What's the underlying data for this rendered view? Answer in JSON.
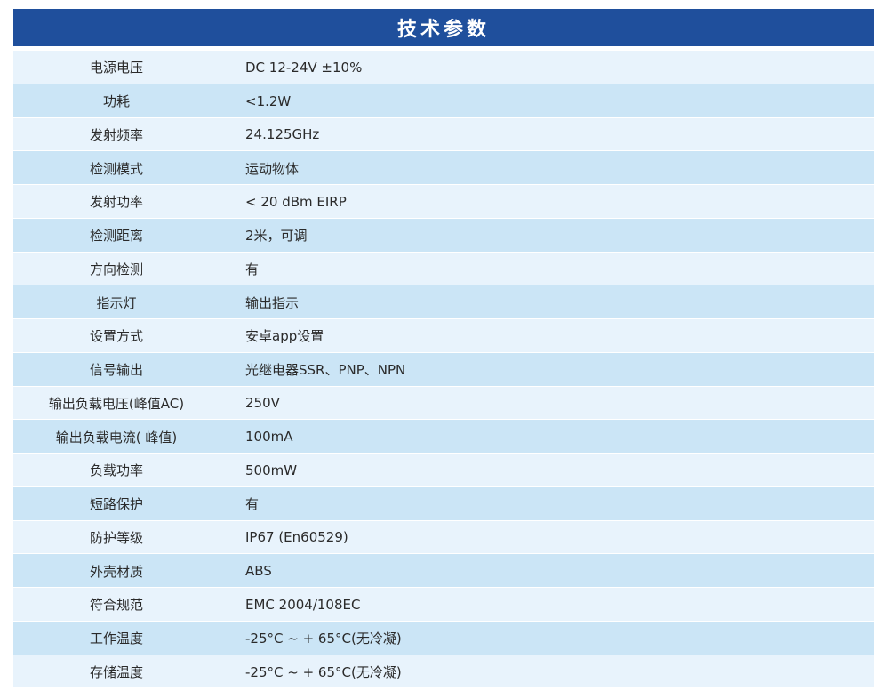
{
  "title": "技术参数",
  "rows": [
    {
      "label": "电源电压",
      "value": "DC 12-24V ±10%"
    },
    {
      "label": "功耗",
      "value": "<1.2W"
    },
    {
      "label": "发射频率",
      "value": "24.125GHz"
    },
    {
      "label": "检测模式",
      "value": "运动物体"
    },
    {
      "label": "发射功率",
      "value": "< 20 dBm EIRP"
    },
    {
      "label": "检测距离",
      "value": "2米，可调"
    },
    {
      "label": "方向检测",
      "value": "有"
    },
    {
      "label": "指示灯",
      "value": "输出指示"
    },
    {
      "label": "设置方式",
      "value": "安卓app设置"
    },
    {
      "label": "信号输出",
      "value": "光继电器SSR、PNP、NPN"
    },
    {
      "label": "输出负载电压(峰值AC)",
      "value": "250V"
    },
    {
      "label": "输出负载电流( 峰值)",
      "value": "100mA"
    },
    {
      "label": "负载功率",
      "value": "500mW"
    },
    {
      "label": "短路保护",
      "value": "有"
    },
    {
      "label": "防护等级",
      "value": "IP67 (En60529)"
    },
    {
      "label": "外壳材质",
      "value": "ABS"
    },
    {
      "label": "符合规范",
      "value": "EMC 2004/108EC"
    },
    {
      "label": "工作温度",
      "value": "-25°C ~ + 65°C(无冷凝)"
    },
    {
      "label": "存储温度",
      "value": "-25°C ~ + 65°C(无冷凝)"
    }
  ],
  "colors": {
    "header_bg": "#1f4f9c",
    "row_light": "#e8f3fc",
    "row_dark": "#cbe5f6"
  }
}
